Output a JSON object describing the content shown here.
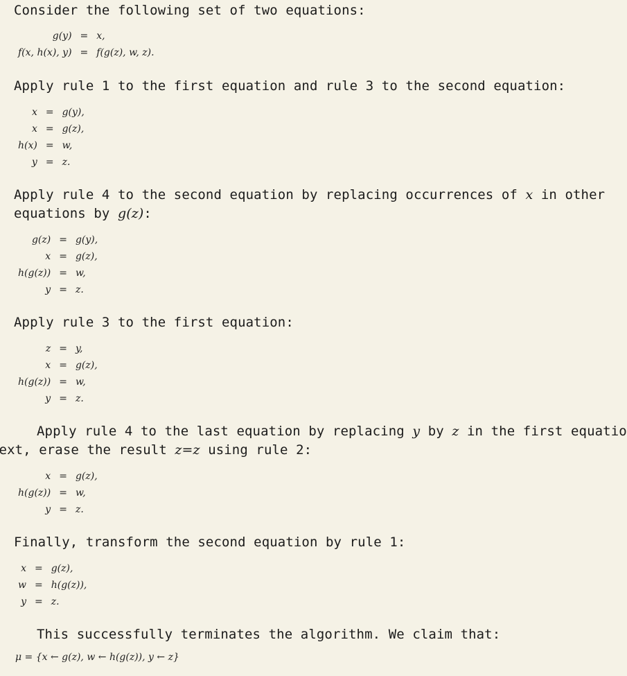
{
  "intro": "Consider the following set of two equations:",
  "system0": [
    {
      "lhs": "g(y)",
      "op": "=",
      "rhs": "x,"
    },
    {
      "lhs": "f(x, h(x), y)",
      "op": "=",
      "rhs": "f(g(z), w, z)."
    }
  ],
  "step1": "Apply rule 1 to the first equation and rule 3 to the second equation:",
  "system1": [
    {
      "lhs": "x",
      "op": "=",
      "rhs": "g(y),"
    },
    {
      "lhs": "x",
      "op": "=",
      "rhs": "g(z),"
    },
    {
      "lhs": "h(x)",
      "op": "=",
      "rhs": "w,"
    },
    {
      "lhs": "y",
      "op": "=",
      "rhs": "z."
    }
  ],
  "step2": {
    "line1_a": "Apply rule 4 to the second equation by replacing occurrences of ",
    "line1_var": "x",
    "line1_b": " in other",
    "line2_a": "equations by ",
    "line2_math": "g(z)",
    "line2_b": ":"
  },
  "system2": [
    {
      "lhs": "g(z)",
      "op": "=",
      "rhs": "g(y),"
    },
    {
      "lhs": "x",
      "op": "=",
      "rhs": "g(z),"
    },
    {
      "lhs": "h(g(z))",
      "op": "=",
      "rhs": "w,"
    },
    {
      "lhs": "y",
      "op": "=",
      "rhs": "z."
    }
  ],
  "step3": "Apply rule 3 to the first equation:",
  "system3": [
    {
      "lhs": "z",
      "op": "=",
      "rhs": "y,"
    },
    {
      "lhs": "x",
      "op": "=",
      "rhs": "g(z),"
    },
    {
      "lhs": "h(g(z))",
      "op": "=",
      "rhs": "w,"
    },
    {
      "lhs": "y",
      "op": "=",
      "rhs": "z."
    }
  ],
  "step4": {
    "line1_a": "Apply rule 4 to the last equation by replacing ",
    "line1_var1": "y",
    "line1_b": " by ",
    "line1_var2": "z",
    "line1_c": " in the first equation;",
    "line2_a": "next, erase the result ",
    "line2_math": "z=z",
    "line2_b": " using rule 2:"
  },
  "system4": [
    {
      "lhs": "x",
      "op": "=",
      "rhs": "g(z),"
    },
    {
      "lhs": "h(g(z))",
      "op": "=",
      "rhs": "w,"
    },
    {
      "lhs": "y",
      "op": "=",
      "rhs": "z."
    }
  ],
  "step5": "Finally, transform the second equation by rule 1:",
  "system5": [
    {
      "lhs": "x",
      "op": "=",
      "rhs": "g(z),"
    },
    {
      "lhs": "w",
      "op": "=",
      "rhs": "h(g(z)),"
    },
    {
      "lhs": "y",
      "op": "=",
      "rhs": "z."
    }
  ],
  "conclusion": "This successfully terminates the algorithm. We claim that:",
  "result": "μ = {x ← g(z), w ← h(g(z)), y ← z}"
}
